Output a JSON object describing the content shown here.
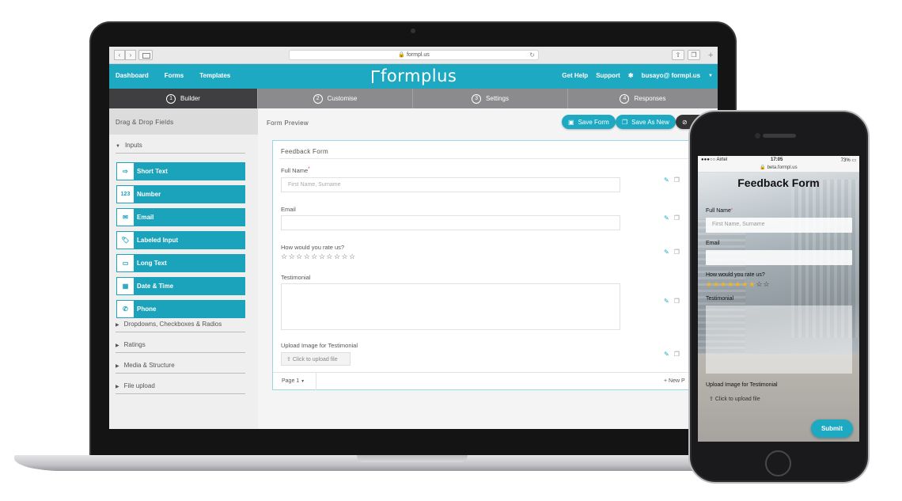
{
  "browser": {
    "url": "formpl.us"
  },
  "header": {
    "nav": [
      "Dashboard",
      "Forms",
      "Templates"
    ],
    "logo": "formplus",
    "right": {
      "help": "Get Help",
      "support": "Support",
      "user": "busayo@ formpl.us"
    }
  },
  "steps": [
    {
      "num": "1",
      "label": "Builder"
    },
    {
      "num": "2",
      "label": "Customise"
    },
    {
      "num": "3",
      "label": "Settings"
    },
    {
      "num": "4",
      "label": "Responses"
    }
  ],
  "sidebar": {
    "title": "Drag & Drop Fields",
    "inputs_label": "Inputs",
    "fields": [
      {
        "label": "Short Text",
        "icon": "⇨"
      },
      {
        "label": "Number",
        "icon": "123"
      },
      {
        "label": "Email",
        "icon": "✉"
      },
      {
        "label": "Labeled Input",
        "icon": "🏷"
      },
      {
        "label": "Long Text",
        "icon": "▭"
      },
      {
        "label": "Date & Time",
        "icon": "▦"
      },
      {
        "label": "Phone",
        "icon": "✆"
      }
    ],
    "sections": [
      "Dropdowns, Checkboxes & Radios",
      "Ratings",
      "Media & Structure",
      "File upload"
    ]
  },
  "preview": {
    "title": "Form Preview",
    "save_form": "Save Form",
    "save_as_new": "Save As New",
    "form_title": "Feedback Form",
    "fields": {
      "full_name": {
        "label": "Full Name",
        "placeholder": "First Name, Surname"
      },
      "email": {
        "label": "Email"
      },
      "rating": {
        "label": "How would you rate us?",
        "stars": "☆☆☆☆☆☆☆☆☆☆"
      },
      "testimonial": {
        "label": "Testimonial"
      },
      "upload": {
        "label": "Upload Image for Testimonial",
        "button": "Click to upload file"
      }
    },
    "page": "Page 1",
    "new_page": "+ New P"
  },
  "phone": {
    "carrier": "●●●○○ Airtel",
    "time": "17:05",
    "battery": "73%",
    "url": "beta.formpl.us",
    "title": "Feedback Form",
    "full_name": "Full Name",
    "placeholder": "First Name, Surname",
    "email": "Email",
    "rating": "How would you rate us?",
    "stars_on": "★★★★★★★",
    "stars_off": "☆☆",
    "testimonial": "Testimonial",
    "upload_label": "Upload Image for Testimonial",
    "upload_button": "Click to upload file",
    "submit": "Submit"
  }
}
